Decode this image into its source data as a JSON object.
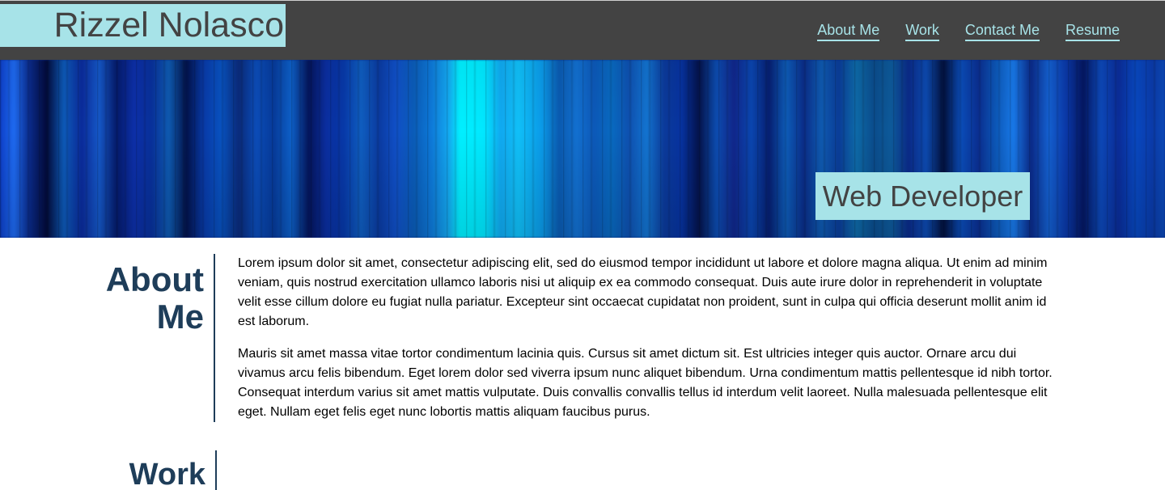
{
  "header": {
    "logo": "Rizzel Nolasco",
    "nav": [
      {
        "label": "About Me"
      },
      {
        "label": "Work"
      },
      {
        "label": "Contact Me"
      },
      {
        "label": "Resume"
      }
    ]
  },
  "hero": {
    "title": "Web Developer"
  },
  "sections": {
    "about": {
      "heading_line1": "About",
      "heading_line2": "Me",
      "paragraphs": [
        "Lorem ipsum dolor sit amet, consectetur adipiscing elit, sed do eiusmod tempor incididunt ut labore et dolore magna aliqua. Ut enim ad minim veniam, quis nostrud exercitation ullamco laboris nisi ut aliquip ex ea commodo consequat. Duis aute irure dolor in reprehenderit in voluptate velit esse cillum dolore eu fugiat nulla pariatur. Excepteur sint occaecat cupidatat non proident, sunt in culpa qui officia deserunt mollit anim id est laborum.",
        "Mauris sit amet massa vitae tortor condimentum lacinia quis. Cursus sit amet dictum sit. Est ultricies integer quis auctor. Ornare arcu dui vivamus arcu felis bibendum. Eget lorem dolor sed viverra ipsum nunc aliquet bibendum. Urna condimentum mattis pellentesque id nibh tortor. Consequat interdum varius sit amet mattis vulputate. Duis convallis convallis tellus id interdum velit laoreet. Nulla malesuada pellentesque elit eget. Nullam eget felis eget nunc lobortis mattis aliquam faucibus purus."
      ]
    },
    "work": {
      "heading": "Work"
    }
  },
  "colors": {
    "header_bg": "#434343",
    "accent": "#a7e3e8",
    "heading": "#1e3d59"
  }
}
